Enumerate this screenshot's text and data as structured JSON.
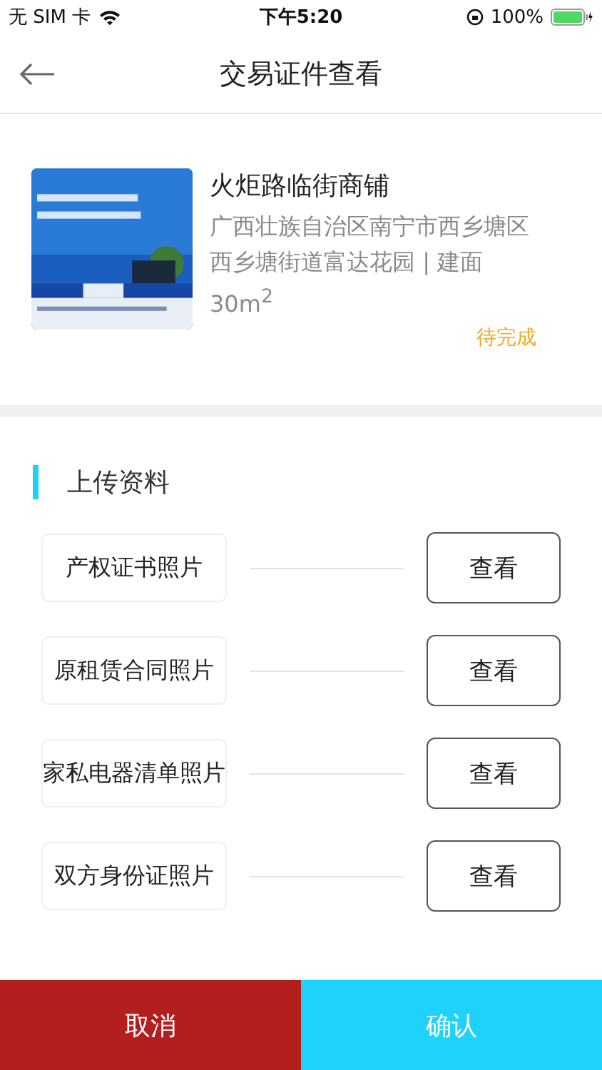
{
  "status_bar": {
    "carrier": "无 SIM 卡",
    "time": "下午5:20",
    "battery": "100%"
  },
  "nav": {
    "title": "交易证件查看"
  },
  "property": {
    "name": "火炬路临街商铺",
    "address": "广西壮族自治区南宁市西乡塘区西乡塘街道富达花园 | 建面30m$^{2}$",
    "status": "待完成"
  },
  "section": {
    "title": "上传资料"
  },
  "documents": [
    {
      "label": "产权证书照片",
      "button": "查看"
    },
    {
      "label": "原租赁合同照片",
      "button": "查看"
    },
    {
      "label": "家私电器清单照片",
      "button": "查看"
    },
    {
      "label": "双方身份证照片",
      "button": "查看"
    }
  ],
  "footer": {
    "cancel": "取消",
    "confirm": "确认"
  }
}
